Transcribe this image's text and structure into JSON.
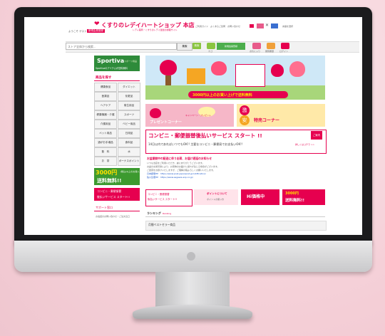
{
  "site": {
    "logo": "くすりのレデイハートショップ 本店",
    "logo_sub": "レディ薬局・くすりのレデイ運営の通販サイト",
    "welcome": "ようこそ ゲスト 様",
    "member_link": "新規会員登録",
    "top_links": "ご利用ガイド　よくあるご質問　お問い合わせ",
    "search_placeholder": "ストア全体から検索...",
    "search_button": "検索",
    "search_scope": "検索",
    "nav_cart_label": "カゴ",
    "nav_register": "新規会員登録",
    "nav_items": [
      "お気に入り",
      "閲覧履歴",
      "ログイン"
    ]
  },
  "sidebar": {
    "sportiva": "Sportiva",
    "sportiva_sub": "スポーツ用品",
    "sportiva_note": "Sportivaのアイテムが送料無料",
    "heading": "商品を探す",
    "categories": [
      [
        "健康食品",
        "ダイエット"
      ],
      [
        "医薬品",
        "化粧品"
      ],
      [
        "ヘアケア",
        "衛生用品"
      ],
      [
        "健康機器・介護",
        "スポーツ"
      ],
      [
        "介護用品",
        "ベビー用品"
      ],
      [
        "ペット用品",
        "日用品"
      ],
      [
        "酒がお手頃品",
        "食料品"
      ],
      [
        "飲　料",
        "水"
      ],
      [
        "お　茶",
        "ボーナスポイント"
      ]
    ],
    "promo_amount": "3000円",
    "promo_note": "(税込)以上のお買い上げで",
    "promo_free": "送料無料!!",
    "cvs_label": "コンビニ・郵便振替",
    "cvs_label2": "後払いサービス スタート!!",
    "support": "サポート窓口",
    "support_line": "お電話のお問い合わせ・ご注文窓口"
  },
  "main": {
    "banner_mid": "3000円以上のお買い上げで送料無料",
    "present_label": "プレゼントコーナー",
    "present_sub": "キャンペーン・プレゼント",
    "gekiyasu": "激",
    "gekiyasu2": "安",
    "sale_label": "特売コーナー",
    "headline": "コンビニ・郵便振替後払いサービス スタート !!",
    "headline_badge": "ご案内",
    "subline": "14日以内であればいつでもOK!! 主要なコンビニ・郵便局でお支払いOK!!",
    "subline_link": "詳しくはコチラ >>",
    "notice_title": "お盆期間中の配送に伴う出荷、お届け遅延のお知らせ",
    "notice_lines": [
      "いつも当店をご利用いただき、誠にありがとうございます。",
      "お盆の交通渋滞により、お荷物のお届けに遅れが生じる場合がございます。",
      "ご迷惑をお掛けいたしますが、ご理解の程よろしくお願いいたします。",
      "日本郵便HP　https://www.post.japanpost.jp/notification/",
      "佐川急便HP　https://www.sagawa-exp.co.jp/"
    ],
    "cvs_small_title": "コンビニ・郵便振替",
    "cvs_small_sub": "後払いサービス スタート!!",
    "point_title": "ポイントについて",
    "point_sub": "ポイントの使い方",
    "kakaku": "Hi価格中",
    "free_ship": "送料無料!!",
    "free_ship_amount": "3000円",
    "ranking": "ランキング",
    "ranking_sub": "Ranking",
    "monthly": "月間ベストセラー商品"
  },
  "colors": {
    "brand": "#e6004f",
    "sidebar_green": "#2e8b3a",
    "banner_sky": "#cfe8f7",
    "bezel": "#1b1b1d",
    "background": "#f7d9df"
  }
}
